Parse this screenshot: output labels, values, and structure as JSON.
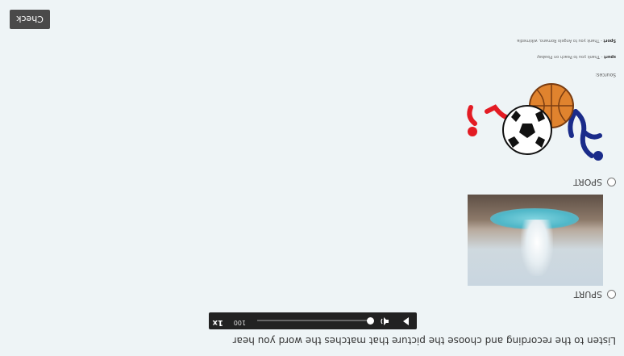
{
  "instruction": "Listen to the recording and choose the picture that matches the word you hear",
  "player": {
    "speed_value": "100",
    "rate_label": "1x"
  },
  "options": [
    {
      "label": "SPURT",
      "image": "geyser-photo"
    },
    {
      "label": "SPORT",
      "image": "sports-balls-illustration"
    }
  ],
  "sources": {
    "heading": "Sources:",
    "credits": [
      {
        "word": "spurt",
        "text": " - Thank you to Peach on Pixabay"
      },
      {
        "word": "Sport",
        "text": " - Thank you to Angelo Romano, wikimedia"
      }
    ]
  },
  "check_button_label": "Check",
  "colors": {
    "background": "#eef4f6",
    "button": "#4a4a4a",
    "player": "#222222"
  }
}
